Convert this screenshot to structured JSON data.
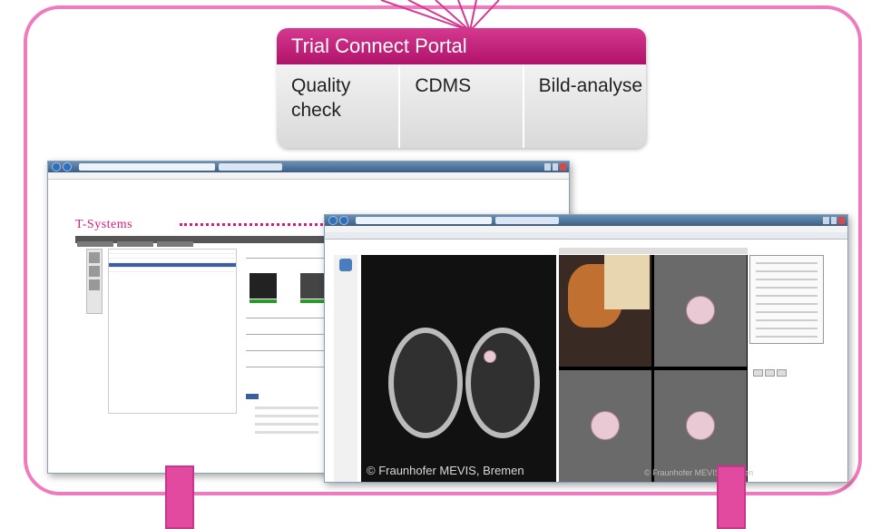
{
  "portal": {
    "title": "Trial Connect Portal",
    "modules": [
      "Quality check",
      "CDMS",
      "Bild-analyse"
    ]
  },
  "screenshot1": {
    "logo_text": "T-Systems"
  },
  "screenshot2": {
    "copyright": "© Fraunhofer MEVIS, Bremen"
  },
  "colors": {
    "brand_magenta": "#d81a7a",
    "frame_pink": "#f07ac0"
  }
}
